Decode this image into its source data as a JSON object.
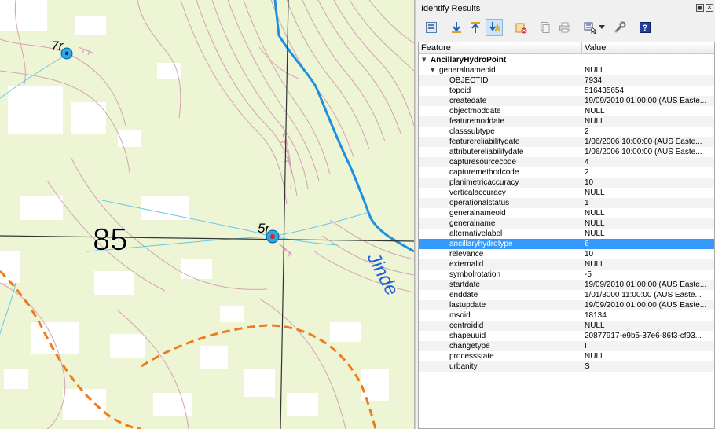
{
  "map": {
    "labels": {
      "grid": "85",
      "point_a": "7r",
      "point_b": "5r",
      "river": "Jinde"
    },
    "colors": {
      "background": "#eef5d4",
      "vegetation": "#ffffff",
      "contour": "#d3a1b6",
      "creek": "#66c8e8",
      "river": "#1e90e0",
      "track": "#f07a1e",
      "gridline": "#333333",
      "point_fill": "#2aa8e8",
      "point_selected": "#e02020"
    }
  },
  "panel": {
    "title": "Identify Results",
    "window_buttons": [
      "▣",
      "✕"
    ],
    "toolbar": [
      {
        "name": "expand-tree-icon",
        "active": false
      },
      {
        "name": "expand-new-results-icon",
        "active": false
      },
      {
        "name": "collapse-all-icon",
        "active": false
      },
      {
        "name": "expand-all-icon",
        "active": true
      },
      {
        "name": "clear-results-icon",
        "active": false
      },
      {
        "name": "copy-feature-icon",
        "active": false
      },
      {
        "name": "print-icon",
        "active": false
      },
      {
        "name": "identify-mode-icon",
        "active": false
      },
      {
        "name": "dropdown-arrow-icon",
        "active": false
      },
      {
        "name": "settings-wrench-icon",
        "active": false
      },
      {
        "name": "help-icon",
        "active": false
      }
    ],
    "columns": {
      "feature": "Feature",
      "value": "Value"
    },
    "layer": "AncillaryHydroPoint",
    "group": {
      "label": "generalnameoid",
      "value": "NULL"
    },
    "rows": [
      {
        "field": "OBJECTID",
        "value": "7934"
      },
      {
        "field": "topoid",
        "value": "516435654"
      },
      {
        "field": "createdate",
        "value": "19/09/2010 01:00:00 (AUS Easte..."
      },
      {
        "field": "objectmoddate",
        "value": "NULL"
      },
      {
        "field": "featuremoddate",
        "value": "NULL"
      },
      {
        "field": "classsubtype",
        "value": "2"
      },
      {
        "field": "featurereliabilitydate",
        "value": "1/06/2006 10:00:00 (AUS Easte..."
      },
      {
        "field": "attributereliabilitydate",
        "value": "1/06/2006 10:00:00 (AUS Easte..."
      },
      {
        "field": "capturesourcecode",
        "value": "4"
      },
      {
        "field": "capturemethodcode",
        "value": "2"
      },
      {
        "field": "planimetricaccuracy",
        "value": "10"
      },
      {
        "field": "verticalaccuracy",
        "value": "NULL"
      },
      {
        "field": "operationalstatus",
        "value": "1"
      },
      {
        "field": "generalnameoid",
        "value": "NULL"
      },
      {
        "field": "generalname",
        "value": "NULL"
      },
      {
        "field": "alternativelabel",
        "value": "NULL"
      },
      {
        "field": "ancillaryhydrotype",
        "value": "6"
      },
      {
        "field": "relevance",
        "value": "10"
      },
      {
        "field": "externalid",
        "value": "NULL"
      },
      {
        "field": "symbolrotation",
        "value": "-5"
      },
      {
        "field": "startdate",
        "value": "19/09/2010 01:00:00 (AUS Easte..."
      },
      {
        "field": "enddate",
        "value": "1/01/3000 11:00:00 (AUS Easte..."
      },
      {
        "field": "lastupdate",
        "value": "19/09/2010 01:00:00 (AUS Easte..."
      },
      {
        "field": "msoid",
        "value": "18134"
      },
      {
        "field": "centroidid",
        "value": "NULL"
      },
      {
        "field": "shapeuuid",
        "value": "20877917-e9b5-37e6-86f3-cf93..."
      },
      {
        "field": "changetype",
        "value": "I"
      },
      {
        "field": "processstate",
        "value": "NULL"
      },
      {
        "field": "urbanity",
        "value": "S"
      }
    ],
    "selected_field": "ancillaryhydrotype"
  }
}
